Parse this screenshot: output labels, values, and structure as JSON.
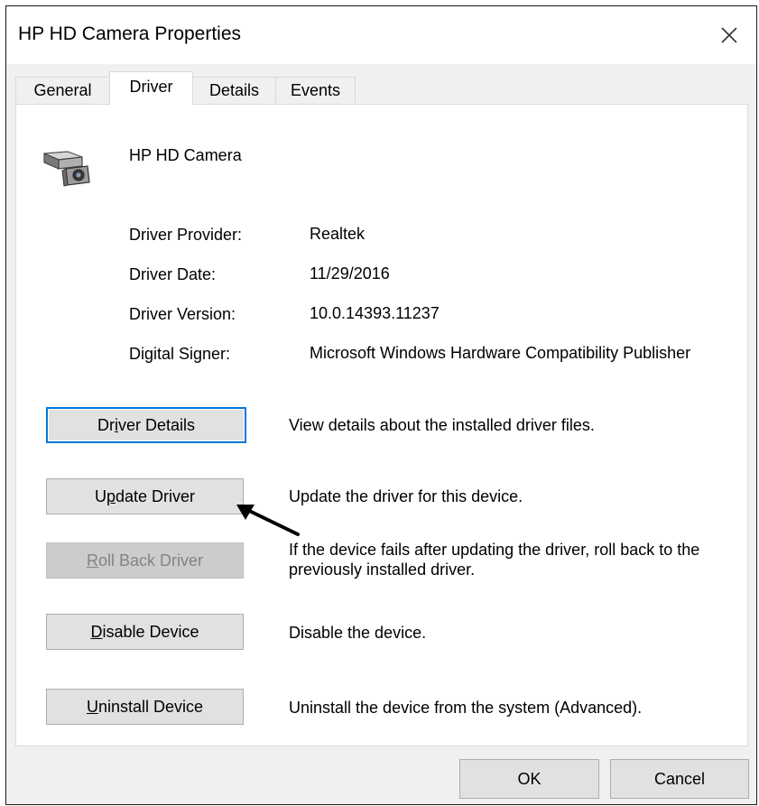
{
  "window": {
    "title": "HP HD Camera Properties",
    "close_icon": "close-icon"
  },
  "tabs": [
    {
      "label": "General",
      "active": false
    },
    {
      "label": "Driver",
      "active": true
    },
    {
      "label": "Details",
      "active": false
    },
    {
      "label": "Events",
      "active": false
    }
  ],
  "device": {
    "name": "HP HD Camera",
    "icon": "webcam-icon"
  },
  "info": [
    {
      "label": "Driver Provider:",
      "value": "Realtek"
    },
    {
      "label": "Driver Date:",
      "value": "11/29/2016"
    },
    {
      "label": "Driver Version:",
      "value": "10.0.14393.11237"
    },
    {
      "label": "Digital Signer:",
      "value": "Microsoft Windows Hardware Compatibility Publisher"
    }
  ],
  "actions": [
    {
      "label": "Driver Details",
      "mnemonic_index": 2,
      "description": "View details about the installed driver files.",
      "enabled": true,
      "focused": true
    },
    {
      "label": "Update Driver",
      "mnemonic_index": 1,
      "description": "Update the driver for this device.",
      "enabled": true,
      "focused": false
    },
    {
      "label": "Roll Back Driver",
      "mnemonic_index": 0,
      "description": "If the device fails after updating the driver, roll back to the previously installed driver.",
      "enabled": false,
      "focused": false
    },
    {
      "label": "Disable Device",
      "mnemonic_index": 0,
      "description": "Disable the device.",
      "enabled": true,
      "focused": false
    },
    {
      "label": "Uninstall Device",
      "mnemonic_index": 0,
      "description": "Uninstall the device from the system (Advanced).",
      "enabled": true,
      "focused": false
    }
  ],
  "footer": {
    "ok_label": "OK",
    "cancel_label": "Cancel"
  },
  "colors": {
    "focus": "#0078d7",
    "button_face": "#e1e1e1",
    "disabled_text": "#838383"
  }
}
